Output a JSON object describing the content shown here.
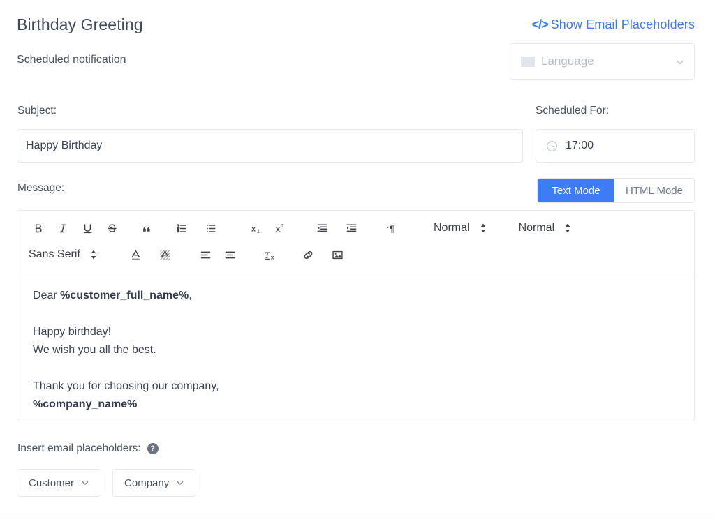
{
  "header": {
    "title": "Birthday Greeting",
    "subtitle": "Scheduled notification",
    "show_placeholders_link": "Show Email Placeholders",
    "code_glyph": "</>",
    "language_select": {
      "placeholder": "Language",
      "flag_icon": "flag-placeholder-icon",
      "chevron_icon": "chevron-down-icon"
    }
  },
  "subject": {
    "label": "Subject:",
    "value": "Happy Birthday"
  },
  "scheduled": {
    "label": "Scheduled For:",
    "value": "17:00",
    "icon": "clock-icon"
  },
  "message": {
    "label": "Message:",
    "modes": {
      "text": "Text Mode",
      "html": "HTML Mode",
      "active": "Text Mode"
    }
  },
  "toolbar": {
    "row1": [
      {
        "name": "bold",
        "glyph": "B"
      },
      {
        "name": "italic",
        "glyph": "I"
      },
      {
        "name": "underline",
        "glyph": "U"
      },
      {
        "name": "strikethrough",
        "glyph": "S"
      },
      {
        "name": "blockquote",
        "glyph": "”"
      },
      {
        "name": "ordered-list",
        "glyph": "1."
      },
      {
        "name": "bullet-list",
        "glyph": "•"
      },
      {
        "name": "subscript",
        "glyph": "x₂"
      },
      {
        "name": "superscript",
        "glyph": "x²"
      },
      {
        "name": "outdent",
        "glyph": "←"
      },
      {
        "name": "indent",
        "glyph": "→"
      },
      {
        "name": "text-direction",
        "glyph": "¶"
      }
    ],
    "size_select": "Normal",
    "header_select": "Normal",
    "font_select": "Sans Serif",
    "row2": [
      {
        "name": "text-color",
        "glyph": "A"
      },
      {
        "name": "background-color",
        "glyph": "A"
      },
      {
        "name": "align",
        "glyph": "≡"
      },
      {
        "name": "clear-formatting",
        "glyph": "Tx"
      },
      {
        "name": "link",
        "glyph": "🔗"
      },
      {
        "name": "image",
        "glyph": "🖼"
      }
    ]
  },
  "body": {
    "line1_prefix": "Dear ",
    "line1_placeholder": "%customer_full_name%",
    "line1_suffix": ",",
    "line2": "Happy birthday!",
    "line3": "We wish you all the best.",
    "line4": "Thank you for choosing our company,",
    "line5_placeholder": "%company_name%"
  },
  "insert": {
    "label": "Insert email placeholders:",
    "help_icon": "help-circle-icon",
    "help_glyph": "?",
    "buttons": [
      {
        "label": "Customer",
        "name": "customer"
      },
      {
        "label": "Company",
        "name": "company"
      }
    ]
  },
  "colors": {
    "accent": "#3d7cf4",
    "text": "#3c4257",
    "muted": "#b6bcc8",
    "border": "#e6e9ef"
  }
}
